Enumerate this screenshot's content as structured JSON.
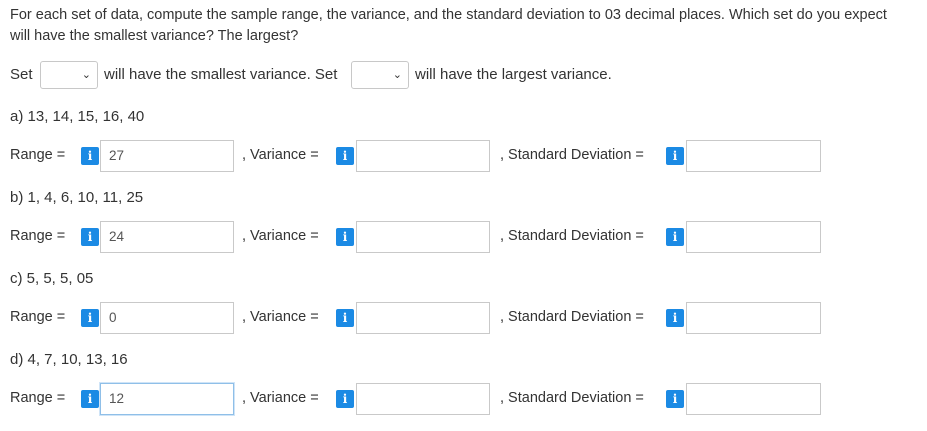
{
  "question": "For each set of data, compute the sample range, the variance, and the standard deviation to 03 decimal places. Which set do you expect will have the smallest variance? The largest?",
  "set_row": {
    "set_label_1": "Set",
    "smallest_text": "will have the smallest variance. Set",
    "largest_text": "will have the largest variance.",
    "select_smallest_value": "",
    "select_largest_value": "",
    "chevron": "⌄"
  },
  "labels": {
    "range": "Range =",
    "variance": ", Variance =",
    "std": ", Standard Deviation =",
    "info": "i"
  },
  "datasets": [
    {
      "title": "a) 13, 14, 15, 16, 40",
      "range": "27",
      "variance": "",
      "std": ""
    },
    {
      "title": "b) 1, 4, 6, 10, 11, 25",
      "range": "24",
      "variance": "",
      "std": ""
    },
    {
      "title": "c) 5, 5, 5, 05",
      "range": "0",
      "variance": "",
      "std": ""
    },
    {
      "title": "d) 4, 7, 10, 13, 16",
      "range": "12",
      "variance": "",
      "std": ""
    }
  ]
}
